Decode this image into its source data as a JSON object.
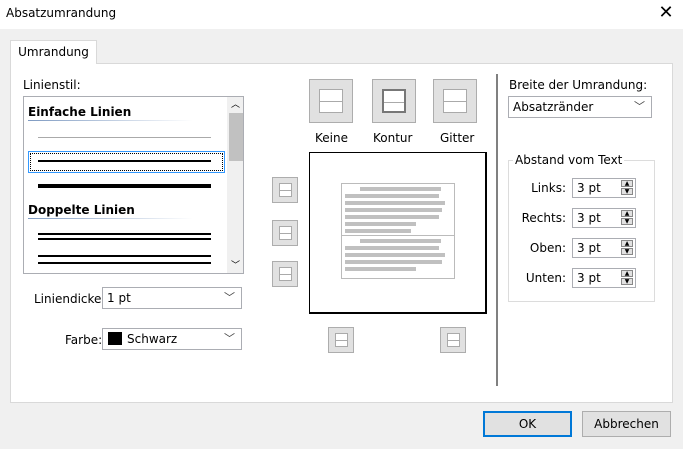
{
  "window": {
    "title": "Absatzumrandung",
    "close_icon": "close-icon"
  },
  "tabs": [
    {
      "label": "Umrandung",
      "active": true
    }
  ],
  "linestyle": {
    "label": "Linienstil:",
    "sections": [
      "Einfache Linien",
      "Doppelte Linien"
    ],
    "selected_index": 1
  },
  "thickness": {
    "label": "Liniendicke:",
    "value": "1 pt"
  },
  "color": {
    "label": "Farbe:",
    "value": "Schwarz",
    "swatch": "#000000"
  },
  "presets": [
    {
      "label": "Keine"
    },
    {
      "label": "Kontur",
      "selected": true
    },
    {
      "label": "Gitter"
    }
  ],
  "width": {
    "label": "Breite der Umrandung:",
    "value": "Absatzränder"
  },
  "spacing": {
    "legend": "Abstand vom Text",
    "fields": [
      {
        "label": "Links:",
        "value": "3 pt"
      },
      {
        "label": "Rechts:",
        "value": "3 pt"
      },
      {
        "label": "Oben:",
        "value": "3 pt"
      },
      {
        "label": "Unten:",
        "value": "3 pt"
      }
    ]
  },
  "buttons": {
    "ok": "OK",
    "cancel": "Abbrechen"
  },
  "colors": {
    "accent": "#0078d7",
    "focus": "#3399ff"
  }
}
